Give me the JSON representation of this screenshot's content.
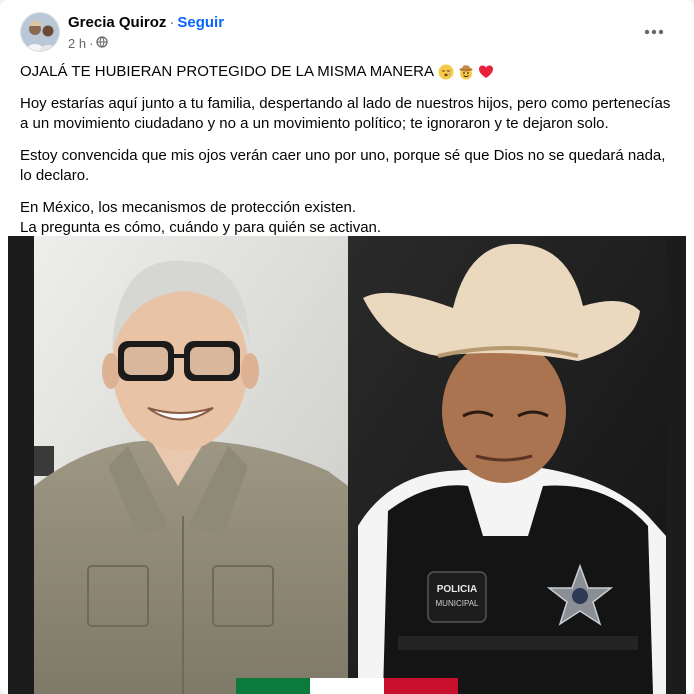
{
  "post": {
    "author": "Grecia Quiroz",
    "separator": "·",
    "follow_label": "Seguir",
    "time": "2 h",
    "privacy_icon": "globe-icon",
    "more_icon": "more-options-icon",
    "title": "OJALÁ TE HUBIERAN PROTEGIDO DE LA MISMA MANERA",
    "title_emojis": [
      "sleepy-face-icon",
      "cowboy-face-icon",
      "red-heart-icon"
    ],
    "paragraph1": "Hoy estarías aquí junto a tu familia, despertando al lado de nuestros hijos, pero como pertenecías a un movimiento ciudadano y no a un movimiento político; te ignoraron y te dejaron solo.",
    "paragraph2": "Estoy convencida que mis ojos verán caer uno por uno, porque sé que Dios no se quedará nada, lo declaro.",
    "paragraph3_line1": "En México, los mecanismos de protección existen.",
    "paragraph3_line2": "La pregunta es cómo, cuándo y para quién se activan."
  },
  "photo": {
    "vest_patch": "POLICIA MUNICIPAL",
    "flag_colors": [
      "#0b7a3b",
      "#ffffff",
      "#c8102e"
    ]
  }
}
